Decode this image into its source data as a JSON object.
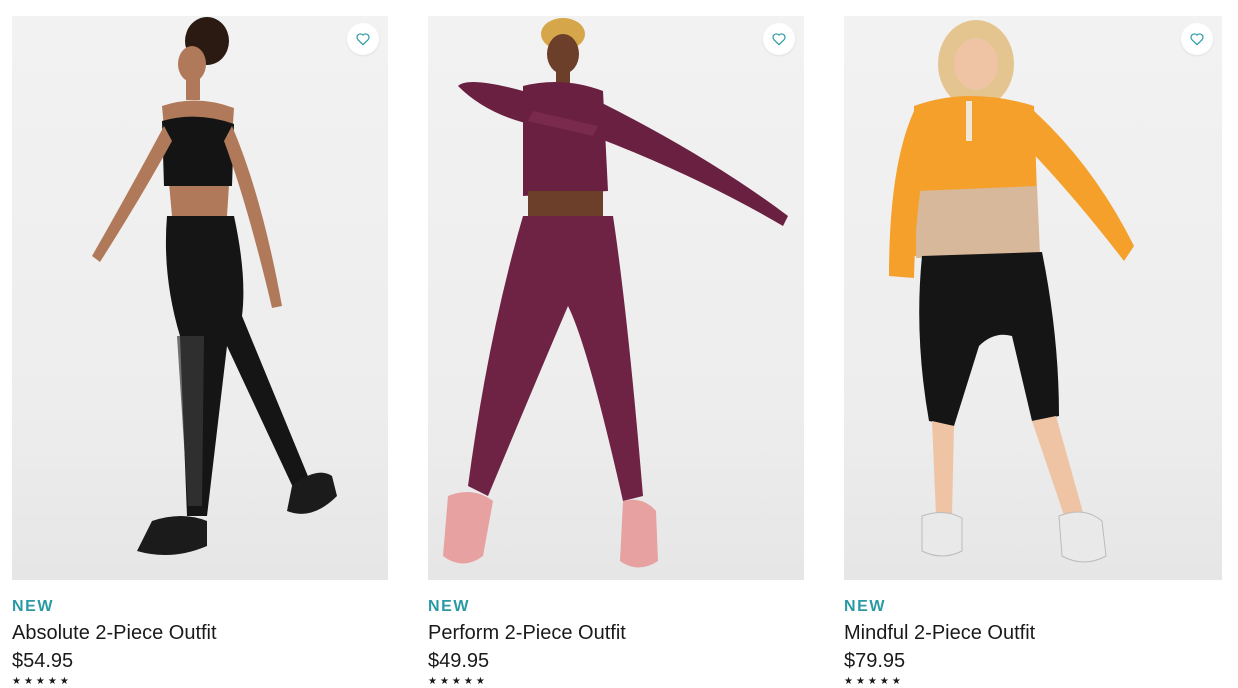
{
  "products": [
    {
      "badge": "NEW",
      "name": "Absolute 2-Piece Outfit",
      "price": "$54.95",
      "stars": "★★★★★",
      "favorite_icon": "heart-outline-icon",
      "colors": {
        "top": "#141414",
        "bottom": "#151515",
        "shoes": "#1b1b1b"
      }
    },
    {
      "badge": "NEW",
      "name": "Perform 2-Piece Outfit",
      "price": "$49.95",
      "stars": "★★★★★",
      "favorite_icon": "heart-outline-icon",
      "colors": {
        "top": "#6a2041",
        "bottom": "#6f2344",
        "shoes": "#e7a1a1"
      }
    },
    {
      "badge": "NEW",
      "name": "Mindful 2-Piece Outfit",
      "price": "$79.95",
      "stars": "★★★★★",
      "favorite_icon": "heart-outline-icon",
      "colors": {
        "top": "#f5a02a",
        "top_band": "#d8b89a",
        "bottom": "#151515",
        "shoes": "#e9e9e9"
      }
    }
  ],
  "accent_color": "#2b9aa5"
}
